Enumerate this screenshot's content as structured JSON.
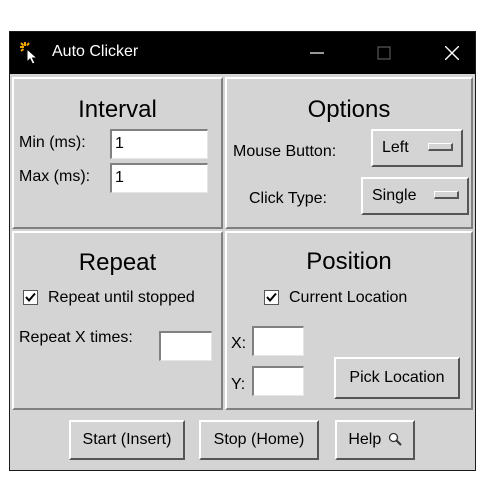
{
  "window": {
    "title": "Auto Clicker"
  },
  "interval": {
    "heading": "Interval",
    "min_label": "Min (ms):",
    "min_value": "1",
    "max_label": "Max (ms):",
    "max_value": "1"
  },
  "options": {
    "heading": "Options",
    "mouse_button_label": "Mouse Button:",
    "mouse_button_value": "Left",
    "click_type_label": "Click Type:",
    "click_type_value": "Single"
  },
  "repeat": {
    "heading": "Repeat",
    "until_stopped_label": "Repeat until stopped",
    "until_stopped_checked": true,
    "times_label": "Repeat X times:",
    "times_value": ""
  },
  "position": {
    "heading": "Position",
    "current_location_label": "Current Location",
    "current_location_checked": true,
    "x_label": "X:",
    "x_value": "",
    "y_label": "Y:",
    "y_value": "",
    "pick_location_label": "Pick Location"
  },
  "footer": {
    "start_label": "Start (Insert)",
    "stop_label": "Stop (Home)",
    "help_label": "Help",
    "help_icon": "magnifier-icon"
  }
}
